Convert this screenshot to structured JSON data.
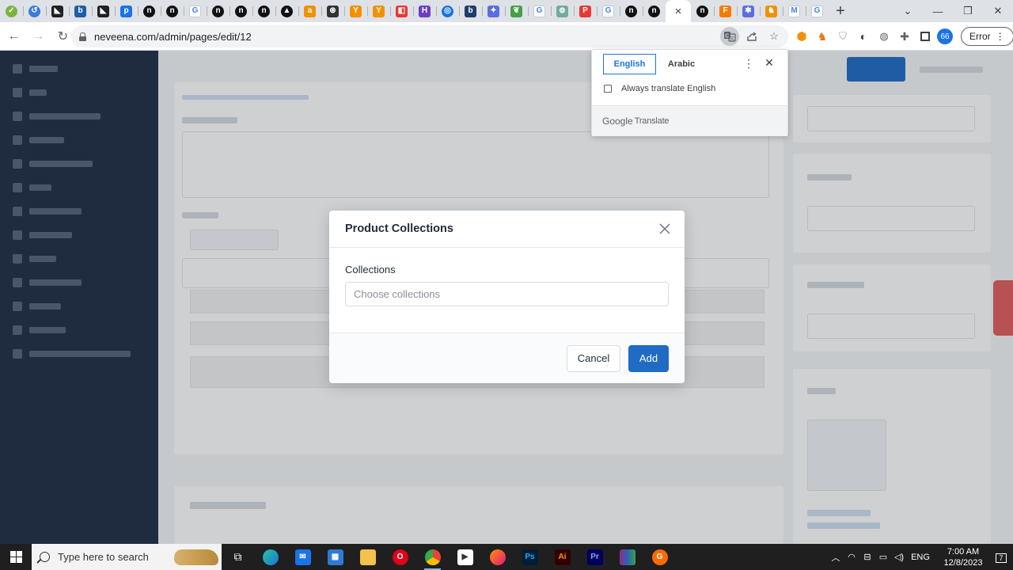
{
  "browser": {
    "tab_favicons": [
      {
        "icon": "check-circle-icon",
        "color": "#7cb342",
        "glyph": "✓"
      },
      {
        "icon": "history-icon",
        "color": "#3b7dd8",
        "glyph": "↺"
      },
      {
        "icon": "site-icon",
        "color": "#202124",
        "glyph": "◣"
      },
      {
        "icon": "b-site-icon",
        "color": "#1e5fa8",
        "glyph": "b"
      },
      {
        "icon": "site-icon",
        "color": "#202124",
        "glyph": "◣"
      },
      {
        "icon": "p-site-icon",
        "color": "#1a73e8",
        "glyph": "p"
      },
      {
        "icon": "n-site-icon",
        "color": "#111111",
        "glyph": "n"
      },
      {
        "icon": "n-site-icon",
        "color": "#111111",
        "glyph": "n"
      },
      {
        "icon": "google-icon",
        "color": "#ffffff",
        "glyph": "G"
      },
      {
        "icon": "n-site-icon",
        "color": "#111111",
        "glyph": "n"
      },
      {
        "icon": "n-site-icon",
        "color": "#111111",
        "glyph": "n"
      },
      {
        "icon": "n-site-icon",
        "color": "#111111",
        "glyph": "n"
      },
      {
        "icon": "triangle-site-icon",
        "color": "#111111",
        "glyph": "▲"
      },
      {
        "icon": "amazon-icon",
        "color": "#f29100",
        "glyph": "a"
      },
      {
        "icon": "chip-site-icon",
        "color": "#333333",
        "glyph": "⊛"
      },
      {
        "icon": "fork-site-icon",
        "color": "#f29100",
        "glyph": "Y"
      },
      {
        "icon": "fork-site-icon",
        "color": "#f29100",
        "glyph": "Y"
      },
      {
        "icon": "red-site-icon",
        "color": "#e53935",
        "glyph": "◧"
      },
      {
        "icon": "h-site-icon",
        "color": "#6a3fc2",
        "glyph": "H"
      },
      {
        "icon": "circle-site-icon",
        "color": "#1a73e8",
        "glyph": "◎"
      },
      {
        "icon": "b-site-icon",
        "color": "#1e3d6b",
        "glyph": "b"
      },
      {
        "icon": "sparkle-icon",
        "color": "#5b6ee1",
        "glyph": "✦"
      },
      {
        "icon": "leaf-icon",
        "color": "#43a047",
        "glyph": "❦"
      },
      {
        "icon": "google-icon",
        "color": "#ffffff",
        "glyph": "G"
      },
      {
        "icon": "openai-icon",
        "color": "#74aa9c",
        "glyph": "⊚"
      },
      {
        "icon": "p-flag-icon",
        "color": "#e53935",
        "glyph": "P"
      },
      {
        "icon": "google-icon",
        "color": "#ffffff",
        "glyph": "G"
      },
      {
        "icon": "n-site-icon",
        "color": "#111111",
        "glyph": "n"
      },
      {
        "icon": "n-site-icon",
        "color": "#111111",
        "glyph": "n"
      }
    ],
    "tab_favicons_after": [
      {
        "icon": "n-site-icon",
        "color": "#111111",
        "glyph": "n"
      },
      {
        "icon": "orange-site-icon",
        "color": "#f57c00",
        "glyph": "F"
      },
      {
        "icon": "puzzle-star-icon",
        "color": "#5b6ee1",
        "glyph": "✱"
      },
      {
        "icon": "fox-icon",
        "color": "#f29100",
        "glyph": "♞"
      },
      {
        "icon": "gmail-icon",
        "color": "#ffffff",
        "glyph": "M"
      },
      {
        "icon": "google-icon",
        "color": "#ffffff",
        "glyph": "G"
      }
    ],
    "active_tab_close": "×",
    "new_tab": "+",
    "url": "neveena.com/admin/pages/edit/12",
    "profile_badge": "66",
    "error_label": "Error"
  },
  "translate_popup": {
    "source_language": "English",
    "target_language": "Arabic",
    "always_translate_label": "Always translate English",
    "brand_google": "Google",
    "brand_translate": "Translate"
  },
  "dialog": {
    "title": "Product Collections",
    "field_label": "Collections",
    "field_placeholder": "Choose collections",
    "cancel_label": "Cancel",
    "add_label": "Add"
  },
  "taskbar": {
    "search_placeholder": "Type here to search",
    "language": "ENG",
    "time": "7:00 AM",
    "date": "12/8/2023",
    "notification_count": "7"
  },
  "colors": {
    "accent": "#206bc4",
    "sidebar": "#1f2d44",
    "translate_accent": "#1a73e8"
  }
}
